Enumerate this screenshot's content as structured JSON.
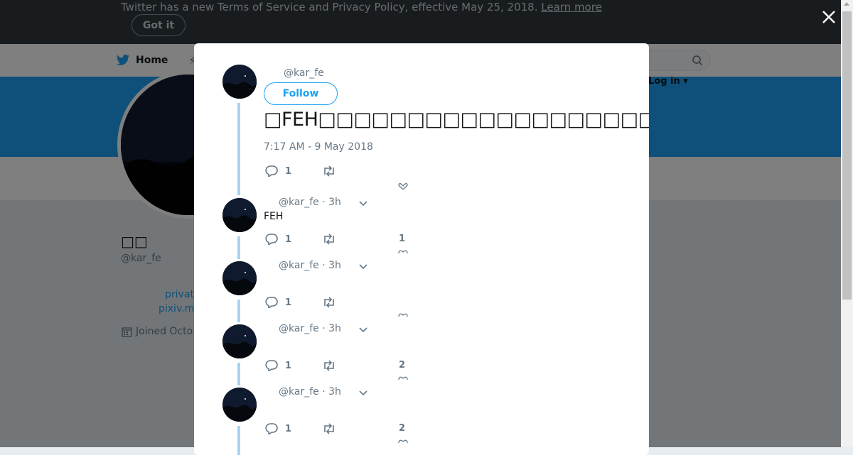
{
  "banner": {
    "text": "Twitter has a new Terms of Service and Privacy Policy, effective May 25, 2018.",
    "link": "Learn more",
    "button": "Got it"
  },
  "nav": {
    "home": "Home",
    "login": "Log in"
  },
  "profile": {
    "name": "□□",
    "handle": "@kar_fe",
    "link1": "privat",
    "link2": "pixiv.m",
    "joined": "Joined Octo"
  },
  "modal": {
    "main_tweet": {
      "handle": "@kar_fe",
      "follow": "Follow",
      "text": "□FEH□□□□□□□□□□□□□□□□□□□□□□□□□□□□□□□□□□",
      "date": "7:17 AM - 9 May 2018",
      "reply_count": "1",
      "like_count": ""
    },
    "replies": [
      {
        "handle": "@kar_fe",
        "time": "· 3h",
        "text": "FEH",
        "reply_count": "1",
        "like_count": "1"
      },
      {
        "handle": "@kar_fe",
        "time": "· 3h",
        "text": "",
        "reply_count": "1",
        "like_count": ""
      },
      {
        "handle": "@kar_fe",
        "time": "· 3h",
        "text": "",
        "reply_count": "1",
        "like_count": "2"
      },
      {
        "handle": "@kar_fe",
        "time": "· 3h",
        "text": "",
        "reply_count": "1",
        "like_count": "2"
      }
    ]
  },
  "icons": {
    "close": "close-icon",
    "reply": "reply-icon",
    "retweet": "retweet-icon",
    "like": "heart-icon",
    "chevron": "chevron-down-icon",
    "search": "search-icon",
    "calendar": "calendar-icon",
    "twitter": "twitter-bird-icon"
  },
  "colors": {
    "brand": "#1da1f2",
    "thread": "#a3d4f5",
    "banner": "#33393f",
    "muted": "#657786"
  }
}
